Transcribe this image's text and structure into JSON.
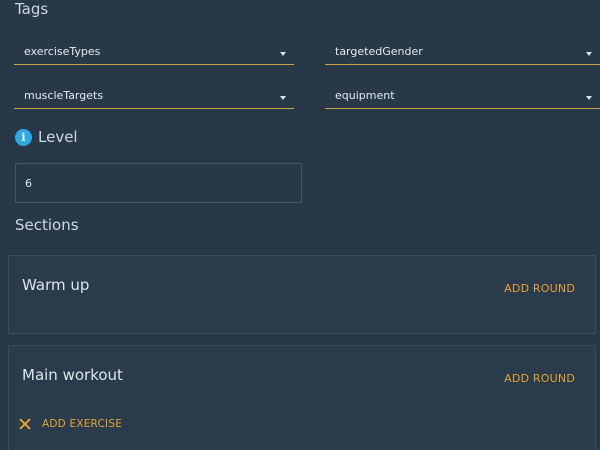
{
  "tags": {
    "heading": "Tags",
    "selects": {
      "exercise_types": "exerciseTypes",
      "targeted_gender": "targetedGender",
      "muscle_targets": "muscleTargets",
      "equipment": "equipment"
    }
  },
  "level": {
    "label": "Level",
    "info_icon": "i",
    "value": "6"
  },
  "sections": {
    "heading": "Sections",
    "cards": [
      {
        "title": "Warm up",
        "add_round_label": "ADD ROUND"
      },
      {
        "title": "Main workout",
        "add_round_label": "ADD ROUND",
        "add_exercise_label": "ADD EXERCISE"
      }
    ]
  },
  "colors": {
    "background": "#283847",
    "accent": "#e6a233",
    "underline": "#c9a24a",
    "info": "#2fa8e8"
  }
}
